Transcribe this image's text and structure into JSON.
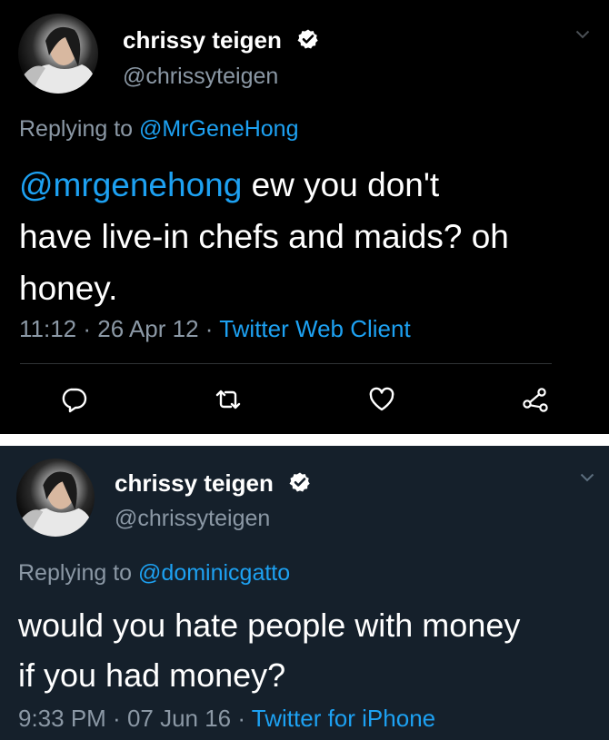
{
  "colors": {
    "panel1_bg": "#000000",
    "panel2_bg": "#15202b",
    "text": "#ffffff",
    "secondary": "#8b98a5",
    "link": "#1da1f2"
  },
  "tweets": [
    {
      "author": {
        "name": "chrissy teigen",
        "handle": "@chrissyteigen",
        "verified": true
      },
      "replying_prefix": "Replying to",
      "replying_to": "@MrGeneHong",
      "body": {
        "mention": "@mrgenehong",
        "line1_text": " ew you don't",
        "line2": "have live-in chefs and maids? oh",
        "line3": "honey."
      },
      "time": "11:12",
      "date": "26 Apr 12",
      "source": "Twitter Web Client",
      "actions": [
        "reply-icon",
        "retweet-icon",
        "like-icon",
        "share-icon"
      ]
    },
    {
      "author": {
        "name": "chrissy teigen",
        "handle": "@chrissyteigen",
        "verified": true
      },
      "replying_prefix": "Replying to",
      "replying_to": "@dominicgatto",
      "body": {
        "line1": "would you hate people with money",
        "line2": "if you had money?"
      },
      "time": "9:33 PM",
      "date": "07 Jun 16",
      "source": "Twitter for iPhone"
    }
  ],
  "separator": " · "
}
